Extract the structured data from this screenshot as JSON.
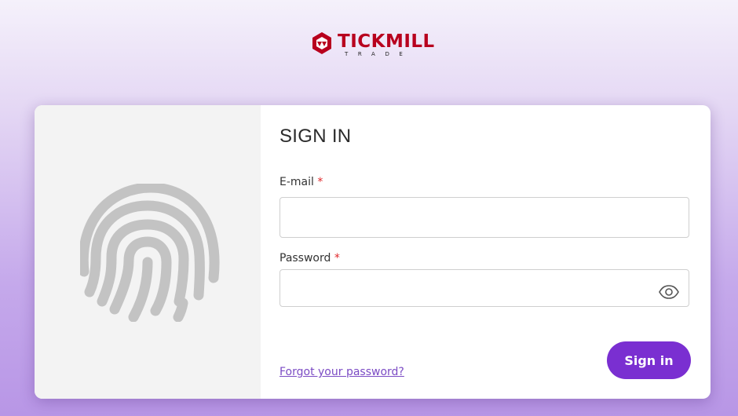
{
  "brand": {
    "name": "TICKMILL",
    "subtitle": "TRADE",
    "color": "#b8001e"
  },
  "signin_form": {
    "title": "SIGN IN",
    "email": {
      "label": "E-mail",
      "required_mark": "*",
      "value": "",
      "placeholder": ""
    },
    "password": {
      "label": "Password",
      "required_mark": "*",
      "value": "",
      "placeholder": ""
    },
    "forgot_link": "Forgot your password?",
    "submit_label": "Sign in"
  },
  "icons": {
    "fingerprint": "fingerprint-icon",
    "password_toggle": "eye-icon"
  },
  "colors": {
    "accent": "#7a2fd1",
    "link": "#7b4bc4",
    "required": "#e0282b"
  }
}
